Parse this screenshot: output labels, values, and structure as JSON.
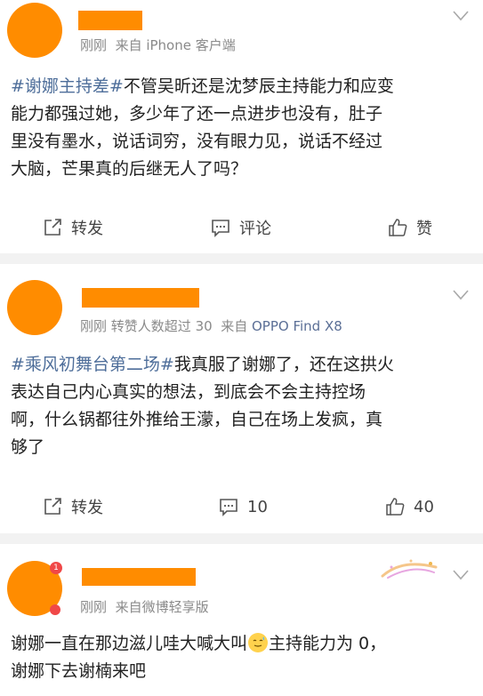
{
  "posts": [
    {
      "meta_time": "刚刚",
      "meta_source": "来自 iPhone 客户端",
      "text": {
        "hashtag": "#谢娜主持差#",
        "line1_rest": "不管吴昕还是沈梦辰主持能力和应变",
        "line2": "能力都强过她，多少年了还一点进步也没有，肚子",
        "line3": "里没有墨水，说话词穷，没有眼力见，说话不经过",
        "line4": "大脑，芒果真的后继无人了吗？"
      },
      "actions": {
        "repost": "转发",
        "comment": "评论",
        "like": "赞"
      }
    },
    {
      "meta_time": "刚刚",
      "meta_extra": "转赞人数超过 30",
      "meta_source_prefix": "来自",
      "meta_source": "OPPO Find X8",
      "text": {
        "hashtag": "#乘风初舞台第二场#",
        "line1_rest": "我真服了谢娜了，还在这拱火",
        "line2": "表达自己内心真实的想法，到底会不会主持控场",
        "line3": "啊，什么锅都往外推给王濛，自己在场上发疯，真",
        "line4": "够了"
      },
      "actions": {
        "repost": "转发",
        "comment": "10",
        "like": "40"
      }
    },
    {
      "meta_time": "刚刚",
      "meta_source": "来自微博轻享版",
      "text": {
        "line1_a": "谢娜一直在那边滋儿哇大喊大叫",
        "line1_b": "主持能力为 0，",
        "line2": "谢娜下去谢楠来吧"
      },
      "badge": "1"
    }
  ],
  "colors": {
    "avatar": "#ff8c00",
    "link": "#4e6e9a",
    "divider": "#f2f2f2"
  }
}
